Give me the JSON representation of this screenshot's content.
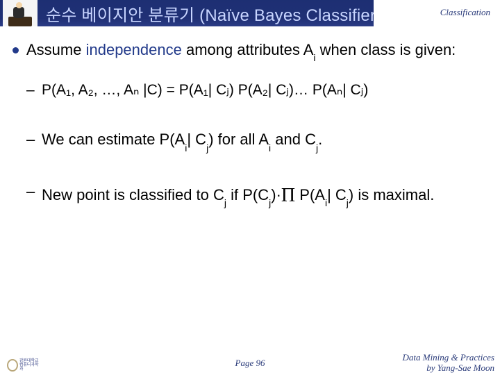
{
  "header": {
    "title_ko": "순수 베이지안 분류기",
    "title_en": "(Naïve Bayes Classifier)",
    "top_right_label": "Classification"
  },
  "content": {
    "bullet1_pre": "Assume ",
    "bullet1_emph": "independence",
    "bullet1_post": " among attributes A",
    "bullet1_sub_i": "i",
    "bullet1_tail": " when class is given:",
    "sub1": "P(A₁, A₂, …, Aₙ |C) = P(A₁| Cⱼ) P(A₂| Cⱼ)… P(Aₙ| Cⱼ)",
    "sub2_pre": "We can estimate P(A",
    "sub2_i1": "i",
    "sub2_mid1": "| C",
    "sub2_j1": "j",
    "sub2_mid2": ") for all A",
    "sub2_i2": "i",
    "sub2_mid3": " and C",
    "sub2_j2": "j",
    "sub2_tail": ".",
    "sub3_pre": "New point is classified to C",
    "sub3_j1": "j",
    "sub3_mid1": " if  P(C",
    "sub3_j2": "j",
    "sub3_mid2": ")·",
    "sub3_prod": "Π",
    "sub3_mid3": " P(A",
    "sub3_i": "i",
    "sub3_mid4": "| C",
    "sub3_j3": "j",
    "sub3_tail": ")  is maximal."
  },
  "footer": {
    "page": "Page 96",
    "credit_line1": "Data Mining & Practices",
    "credit_line2": "by Yang-Sae Moon"
  }
}
